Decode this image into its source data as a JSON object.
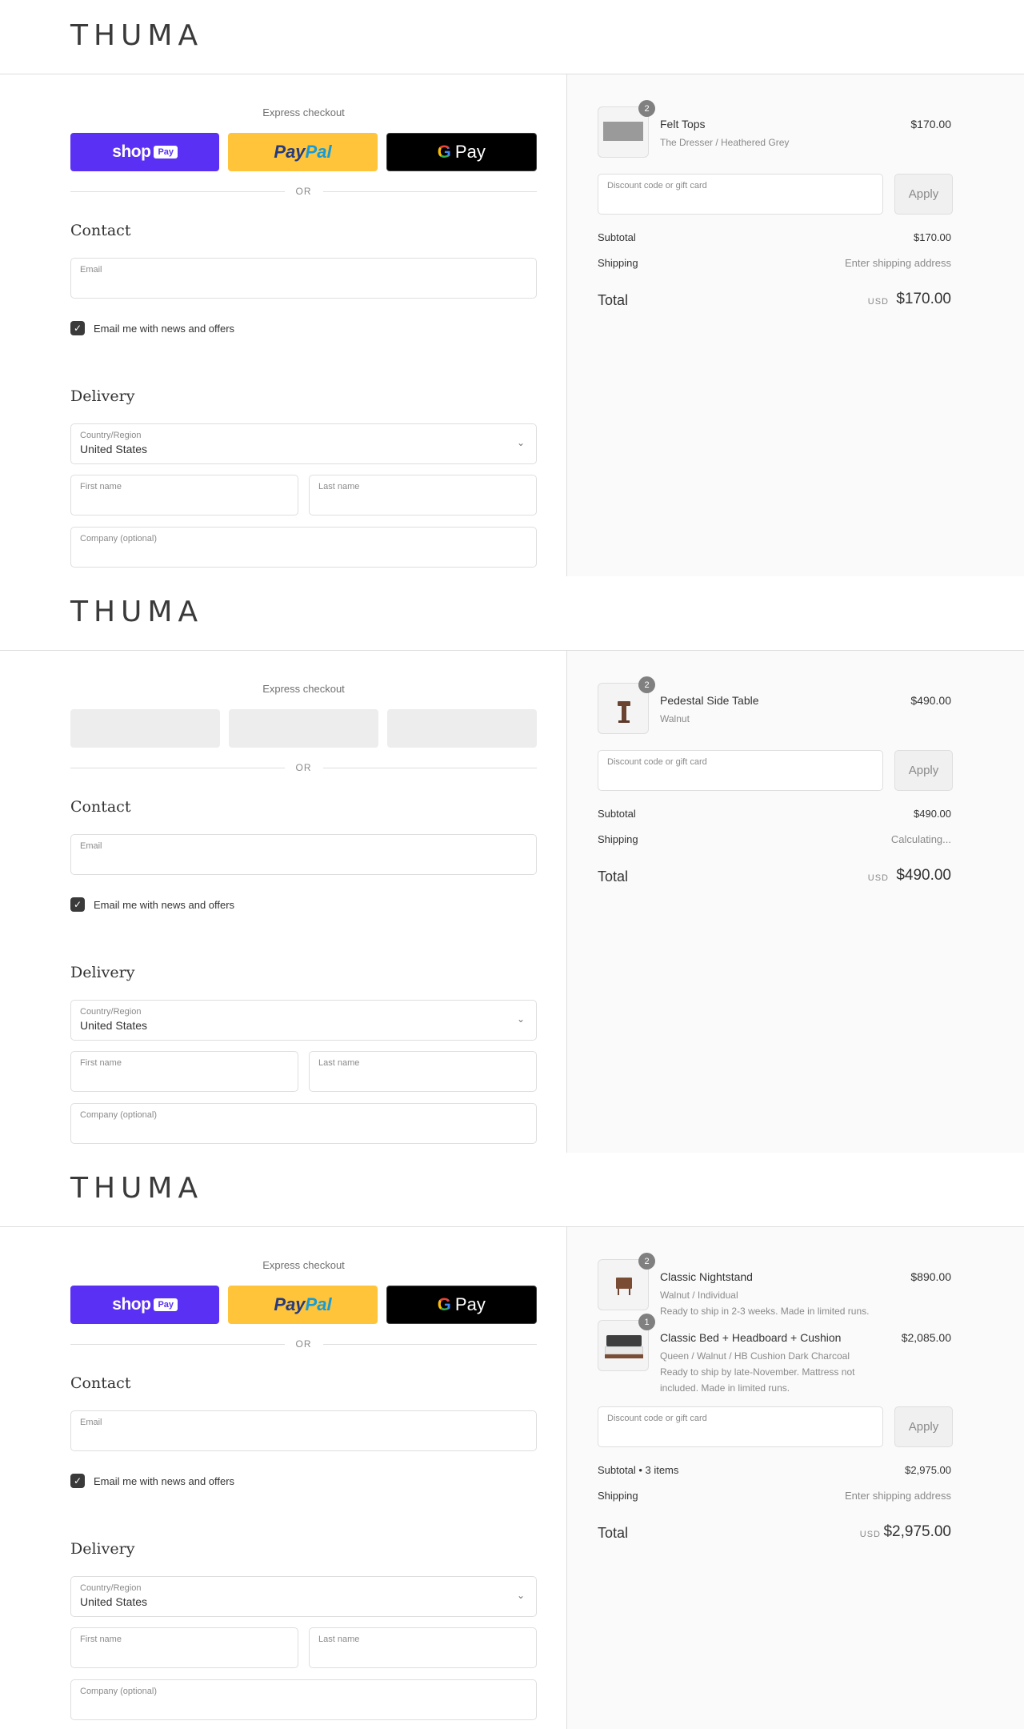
{
  "brand": "THUMA",
  "express_label": "Express checkout",
  "or_label": "OR",
  "contact_title": "Contact",
  "delivery_title": "Delivery",
  "fields": {
    "email": "Email",
    "country_label": "Country/Region",
    "country_value": "United States",
    "first_name": "First name",
    "last_name": "Last name",
    "company": "Company (optional)"
  },
  "newsletter_label": "Email me with news and offers",
  "newsletter_checked": true,
  "payments": {
    "shop_word": "shop",
    "shop_pay": "Pay",
    "paypal_pay": "Pay",
    "paypal_pal": "Pal",
    "gpay_g": "G",
    "gpay_word": "Pay",
    "colors": {
      "shop": "#5a31f4",
      "paypal": "#ffc439",
      "gpay": "#000000"
    }
  },
  "discount_placeholder": "Discount code or gift card",
  "apply_label": "Apply",
  "shipping_label": "Shipping",
  "total_label": "Total",
  "currency": "USD",
  "carts": [
    {
      "items": [
        {
          "title": "Felt Tops",
          "subtitle": "The Dresser / Heathered Grey",
          "price": "$170.00",
          "qty": "2",
          "image": "felt-tops-image"
        }
      ],
      "subtotal_label": "Subtotal",
      "subtotal": "$170.00",
      "shipping_value": "Enter shipping address",
      "total": "$170.00"
    },
    {
      "items": [
        {
          "title": "Pedestal Side Table",
          "subtitle": "Walnut",
          "price": "$490.00",
          "qty": "2",
          "image": "side-table-image"
        }
      ],
      "subtotal_label": "Subtotal",
      "subtotal": "$490.00",
      "shipping_value": "Calculating...",
      "total": "$490.00"
    },
    {
      "items": [
        {
          "title": "Classic Nightstand",
          "subtitle": "Walnut / Individual",
          "note": "Ready to ship in 2-3 weeks. Made in limited runs.",
          "price": "$890.00",
          "qty": "2",
          "image": "nightstand-image"
        },
        {
          "title": "Classic Bed + Headboard + Cushion",
          "subtitle": "Queen / Walnut / HB Cushion Dark Charcoal",
          "note": "Ready to ship by late-November. Mattress not included. Made in limited runs.",
          "price": "$2,085.00",
          "qty": "1",
          "image": "bed-image"
        }
      ],
      "subtotal_label": "Subtotal • 3 items",
      "subtotal": "$2,975.00",
      "shipping_value": "Enter shipping address",
      "total": "$2,975.00"
    }
  ]
}
